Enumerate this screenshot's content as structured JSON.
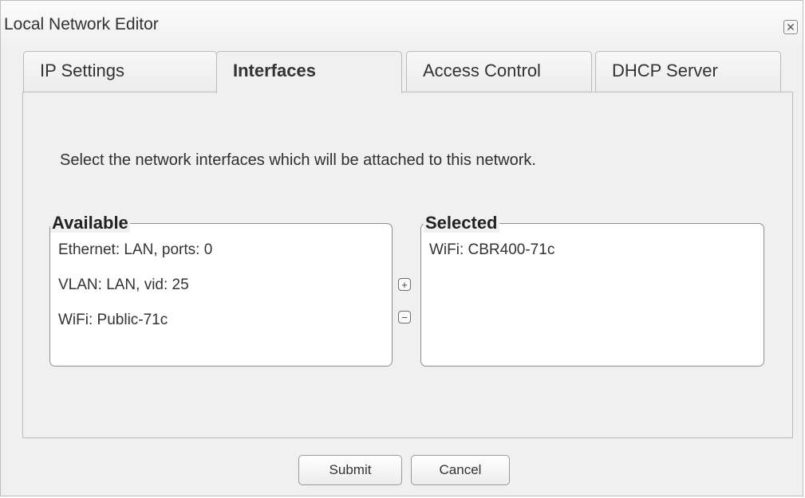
{
  "dialog": {
    "title": "Local Network Editor",
    "close_icon": "close-icon"
  },
  "tabs": [
    {
      "label": "IP Settings",
      "active": false
    },
    {
      "label": "Interfaces",
      "active": true
    },
    {
      "label": "Access Control",
      "active": false
    },
    {
      "label": "DHCP Server",
      "active": false
    }
  ],
  "interfaces": {
    "instruction": "Select the network interfaces which will be attached to this network.",
    "available": {
      "label": "Available",
      "items": [
        "Ethernet: LAN, ports: 0",
        "VLAN: LAN, vid: 25",
        "WiFi: Public-71c"
      ]
    },
    "selected": {
      "label": "Selected",
      "items": [
        "WiFi: CBR400-71c"
      ]
    },
    "add_symbol": "+",
    "remove_symbol": "−"
  },
  "footer": {
    "submit_label": "Submit",
    "cancel_label": "Cancel"
  }
}
